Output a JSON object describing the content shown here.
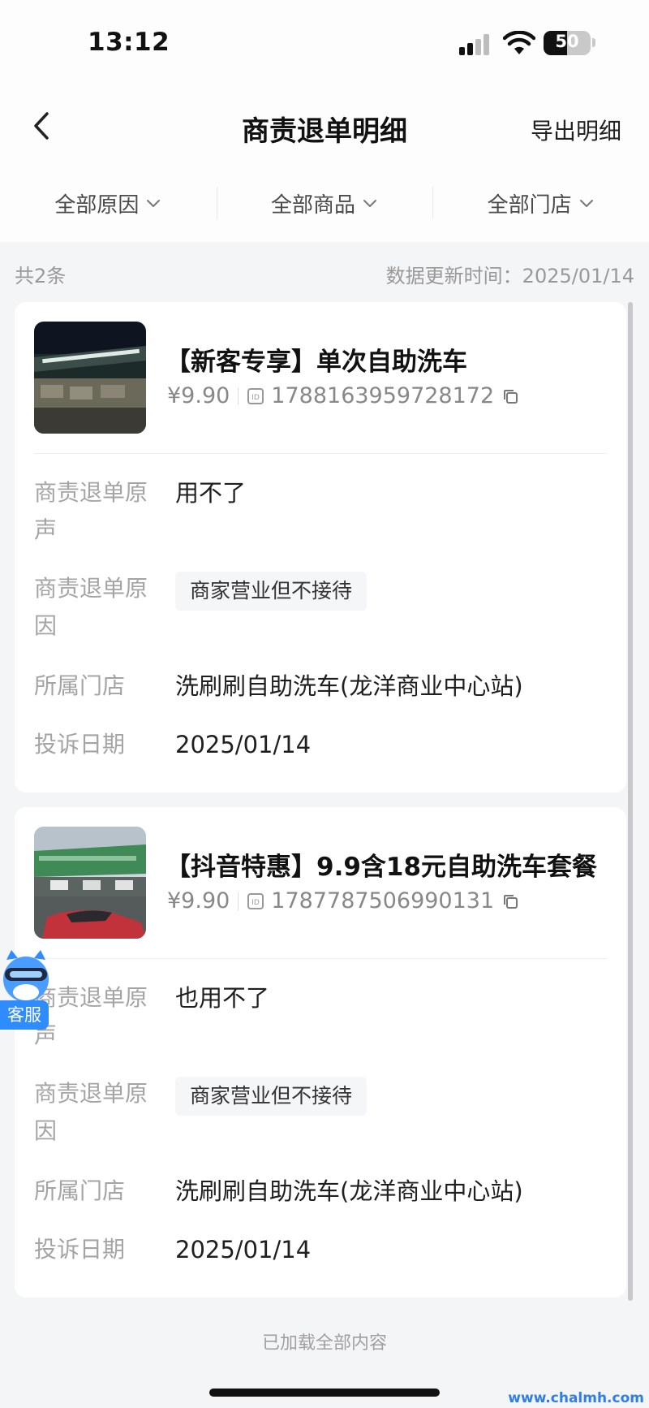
{
  "status_bar": {
    "time": "13:12",
    "battery": "50",
    "battery_level": 0.5
  },
  "nav": {
    "title": "商责退单明细",
    "export_label": "导出明细"
  },
  "filters": [
    {
      "label": "全部原因"
    },
    {
      "label": "全部商品"
    },
    {
      "label": "全部门店"
    }
  ],
  "summary": {
    "count": "共2条",
    "update_time": "数据更新时间：2025/01/14"
  },
  "labels": {
    "voice": "商责退单原声",
    "reason": "商责退单原因",
    "store": "所属门店",
    "date": "投诉日期"
  },
  "items": [
    {
      "title": "【新客专享】单次自助洗车",
      "price": "¥9.90",
      "id": "1788163959728172",
      "voice": "用不了",
      "reason": "商家营业但不接待",
      "store": "洗刷刷自助洗车(龙洋商业中心站)",
      "date": "2025/01/14"
    },
    {
      "title": "【抖音特惠】9.9含18元自助洗车套餐",
      "price": "¥9.90",
      "id": "1787787506990131",
      "voice": "也用不了",
      "reason": "商家营业但不接待",
      "store": "洗刷刷自助洗车(龙洋商业中心站)",
      "date": "2025/01/14"
    }
  ],
  "customer_service": {
    "label": "客服"
  },
  "footer": {
    "note": "已加载全部内容"
  },
  "watermark": "www.chalmh.com",
  "colors": {
    "accent": "#2f8cff",
    "background": "#f4f5f7",
    "card": "#ffffff"
  }
}
